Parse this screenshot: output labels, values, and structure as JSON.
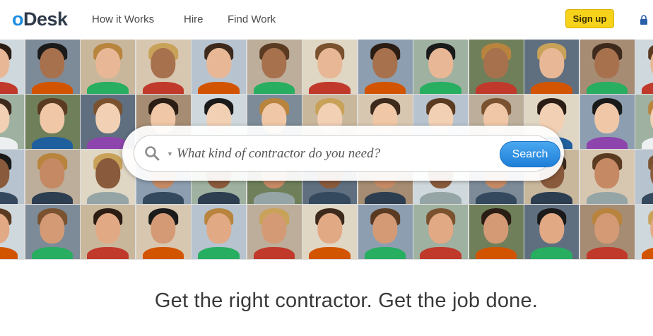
{
  "header": {
    "logo_first": "o",
    "logo_rest": "Desk",
    "nav": [
      "How it Works",
      "Hire",
      "Find Work"
    ],
    "signup_label": "Sign up"
  },
  "search": {
    "placeholder": "What kind of contractor do you need?",
    "button_label": "Search"
  },
  "tagline": "Get the right contractor. Get the job done.",
  "colors": {
    "brand_blue": "#1f8de0",
    "signup_yellow": "#f7d21b",
    "search_button": "#1f7fd8"
  }
}
